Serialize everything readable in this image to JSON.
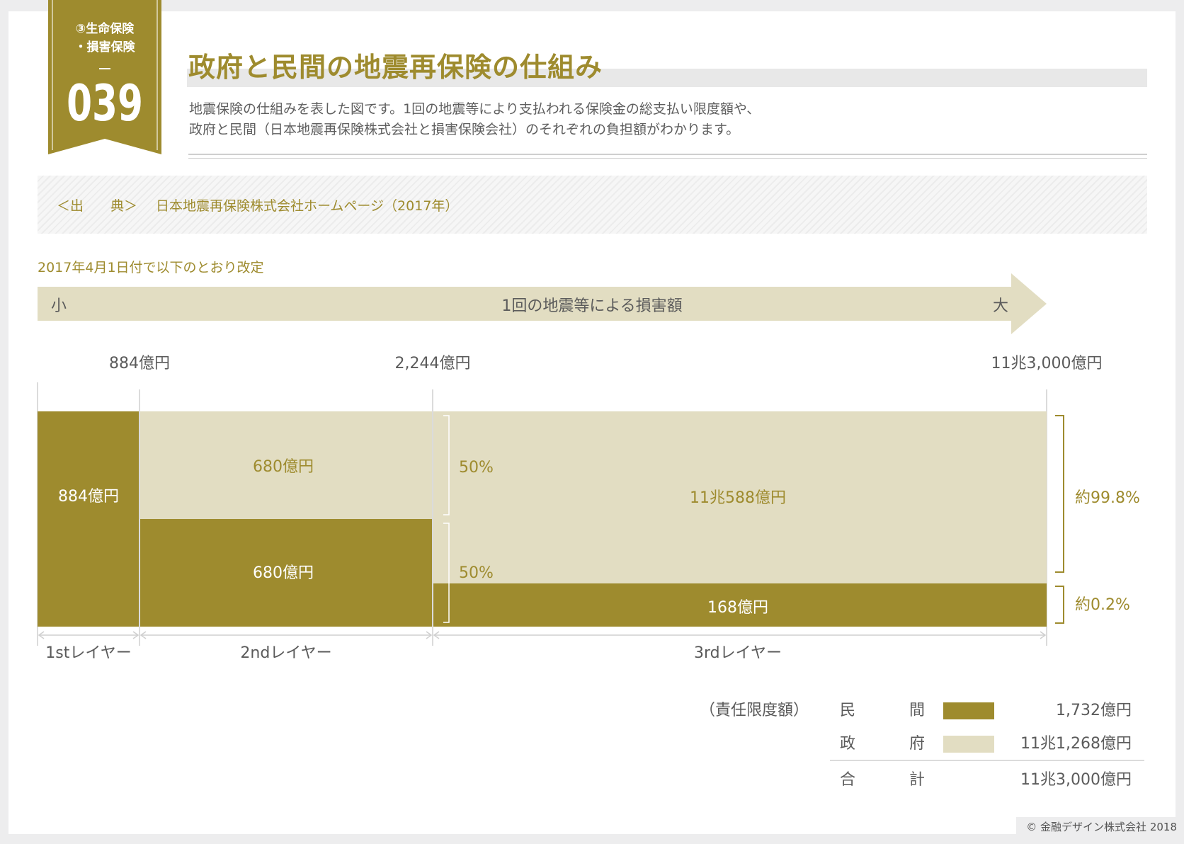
{
  "header": {
    "category_line1": "③生命保険",
    "category_line2": "・損害保険",
    "number": "039",
    "title": "政府と民間の地震再保険の仕組み",
    "description_line1": "地震保険の仕組みを表した図です。1回の地震等により支払われる保険金の総支払い限度額や、",
    "description_line2": "政府と民間（日本地震再保険株式会社と損害保険会社）のそれぞれの負担額がわかります。"
  },
  "source": {
    "label": "＜出　　典＞",
    "text": "日本地震再保険株式会社ホームページ（2017年）"
  },
  "note": "2017年4月1日付で以下のとおり改定",
  "colors": {
    "private": "#9e8b2e",
    "government": "#e2ddc2",
    "arrow": "#e2ddc2",
    "accent_text": "#9e8b2e",
    "dark_text": "#5b5b5b"
  },
  "chart_data": {
    "type": "bar",
    "subtype": "stacked-layer-diagram",
    "arrow": {
      "left": "小",
      "center": "1回の地震等による損害額",
      "right": "大"
    },
    "thresholds": [
      "884億円",
      "2,244億円",
      "11兆3,000億円"
    ],
    "layers": [
      {
        "name": "1stレイヤー",
        "private": {
          "label": "884億円",
          "value": 884
        },
        "government": null
      },
      {
        "name": "2ndレイヤー",
        "private": {
          "label": "680億円",
          "value": 680
        },
        "government": {
          "label": "680億円",
          "value": 680
        }
      },
      {
        "name": "3rdレイヤー",
        "private": {
          "label": "168億円",
          "value": 168
        },
        "government": {
          "label": "11兆588億円",
          "value": 110588
        },
        "share_labels": [
          "50%",
          "50%"
        ]
      }
    ],
    "right_annotations": {
      "government": "約99.8%",
      "private": "約0.2%"
    }
  },
  "legend": {
    "heading": "（責任限度額）",
    "rows": [
      {
        "name_a": "民",
        "name_b": "間",
        "swatch": "private",
        "value": "1,732億円"
      },
      {
        "name_a": "政",
        "name_b": "府",
        "swatch": "government",
        "value": "11兆1,268億円"
      }
    ],
    "total": {
      "name_a": "合",
      "name_b": "計",
      "value": "11兆3,000億円"
    }
  },
  "footer": "© 金融デザイン株式会社 2018"
}
